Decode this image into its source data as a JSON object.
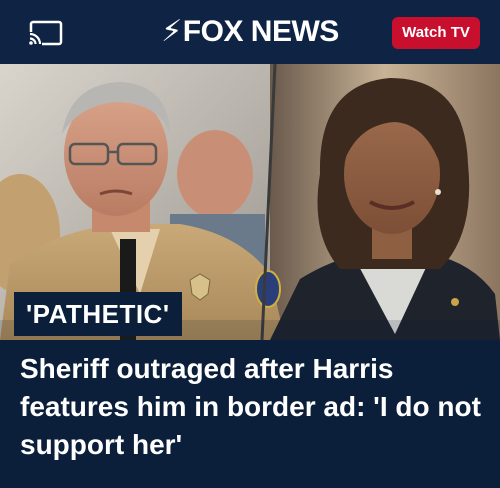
{
  "header": {
    "logo_text": "FOX NEWS",
    "watch_label": "Watch TV",
    "brand_red": "#c8102e",
    "nav_bg": "#0f2444"
  },
  "article": {
    "kicker": "'PATHETIC'",
    "headline": "Sheriff outraged after Harris features him in border ad: 'I do not support her'"
  },
  "icons": {
    "cast": "cast-icon",
    "logo_mark": "fox-logo-mark"
  }
}
